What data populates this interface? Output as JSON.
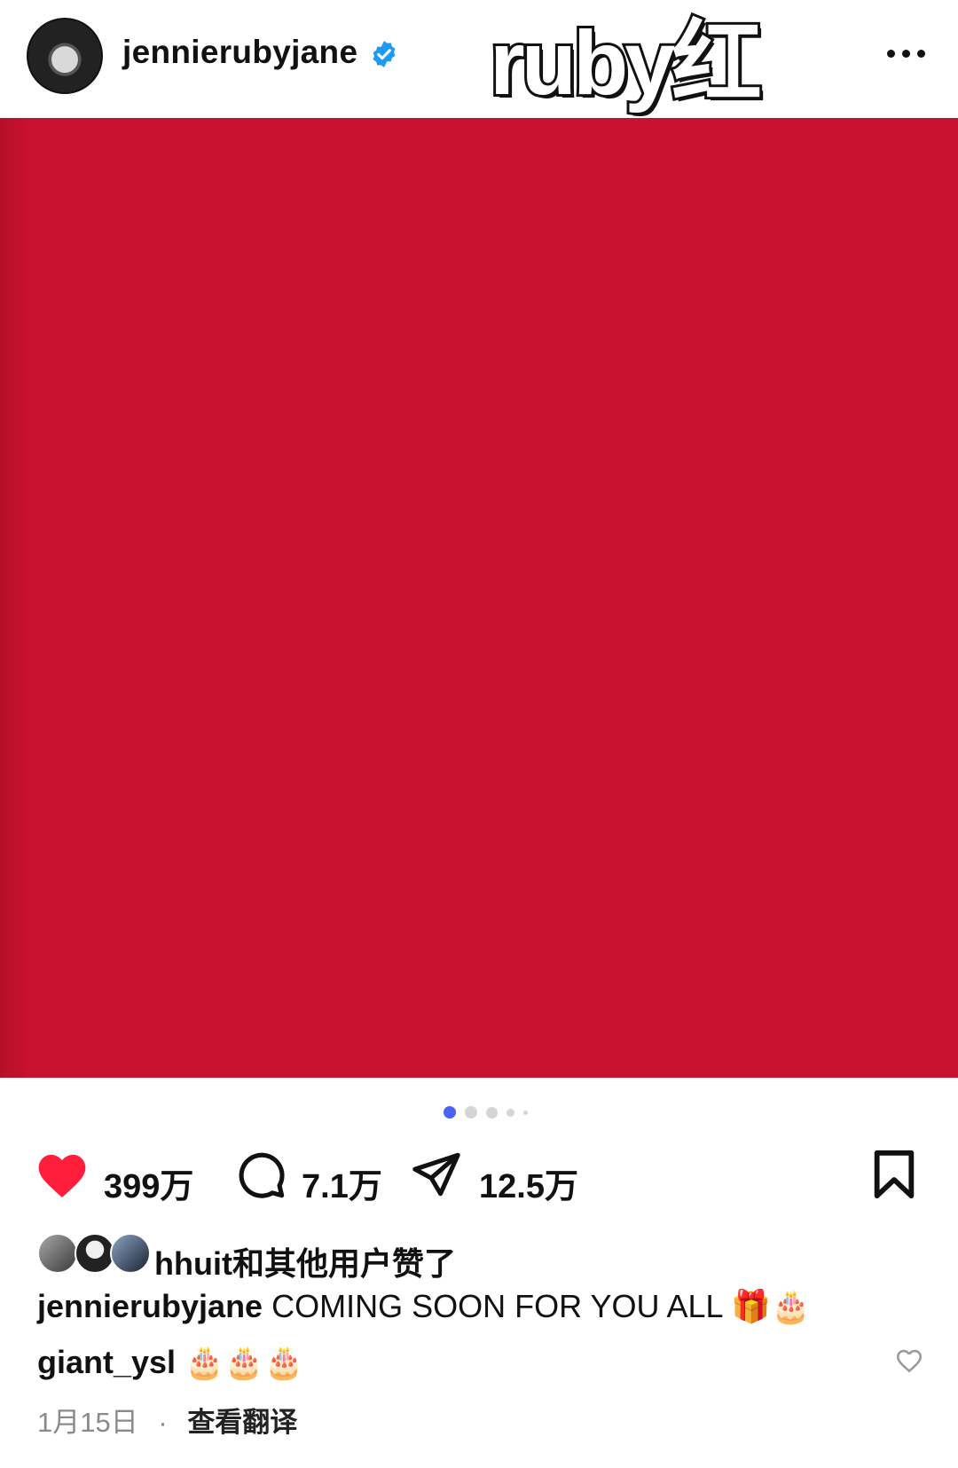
{
  "post": {
    "username": "jennierubyjane",
    "logo_text": "ruby红",
    "likes": "399万",
    "comments": "7.1万",
    "shares": "12.5万",
    "liked_by_text": "hhuit和其他用户赞了",
    "caption_user": "jennierubyjane",
    "caption_text": "COMING SOON FOR YOU ALL 🎁🎂",
    "comment_user": "giant_ysl",
    "comment_text": "🎂🎂🎂",
    "date": "1月15日",
    "date_separator": "·",
    "translate_label": "查看翻译",
    "carousel_total_slides": 5,
    "carousel_active_index": 0
  },
  "colors": {
    "media_red": "#c8112e",
    "like_red": "#ff1f3d",
    "verified_blue": "#1d9bf0",
    "carousel_active": "#4a63f6"
  },
  "icons": [
    "more-options-icon",
    "heart-filled-icon",
    "comment-icon",
    "share-icon",
    "bookmark-icon",
    "heart-outline-icon",
    "verified-badge-icon"
  ]
}
